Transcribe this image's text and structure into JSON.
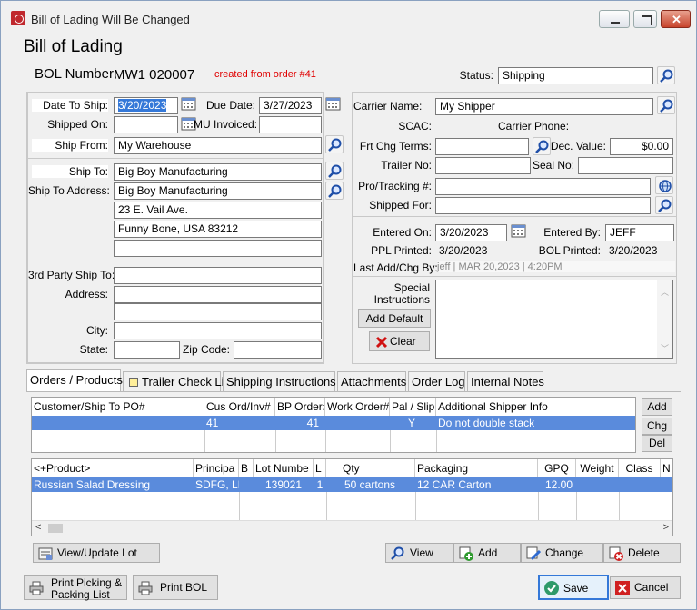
{
  "window": {
    "title": "Bill of Lading Will Be Changed"
  },
  "header": {
    "page_title": "Bill of Lading",
    "bol_label": "BOL Number:",
    "bol_number": "MW1 020007",
    "created_from": "created from order #41",
    "status_label": "Status:",
    "status_value": "Shipping"
  },
  "left": {
    "date_to_ship_label": "Date To Ship:",
    "date_to_ship": "3/20/2023",
    "due_date_label": "Due Date:",
    "due_date": "3/27/2023",
    "shipped_on_label": "Shipped On:",
    "shipped_on": "",
    "mu_invoiced_label": "MU Invoiced:",
    "mu_invoiced": "",
    "ship_from_label": "Ship From:",
    "ship_from": "My Warehouse",
    "ship_to_label": "Ship To:",
    "ship_to": "Big Boy Manufacturing",
    "ship_to_address_label": "Ship To Address:",
    "ship_to_address": [
      "Big Boy Manufacturing",
      "23 E. Vail Ave.",
      "Funny Bone, USA 83212",
      ""
    ],
    "third_party_label": "3rd Party Ship To:",
    "third_party": "",
    "address_label": "Address:",
    "address1": "",
    "address2": "",
    "city_label": "City:",
    "city": "",
    "state_label": "State:",
    "state": "",
    "zip_label": "Zip Code:",
    "zip": ""
  },
  "right": {
    "carrier_name_label": "Carrier Name:",
    "carrier_name": "My Shipper",
    "scac_label": "SCAC:",
    "carrier_phone_label": "Carrier Phone:",
    "frt_chg_terms_label": "Frt Chg Terms:",
    "frt_chg_terms": "",
    "dec_value_label": "Dec. Value:",
    "dec_value": "$0.00",
    "trailer_no_label": "Trailer No:",
    "trailer_no": "",
    "seal_no_label": "Seal No:",
    "seal_no": "",
    "pro_tracking_label": "Pro/Tracking #:",
    "pro_tracking": "",
    "shipped_for_label": "Shipped For:",
    "shipped_for": "",
    "entered_on_label": "Entered On:",
    "entered_on": "3/20/2023",
    "entered_by_label": "Entered By:",
    "entered_by": "JEFF",
    "ppl_printed_label": "PPL Printed:",
    "ppl_printed": "3/20/2023",
    "bol_printed_label": "BOL Printed:",
    "bol_printed": "3/20/2023",
    "last_add_label": "Last Add/Chg By:",
    "last_add": "jeff | MAR 20,2023 | 4:20PM",
    "special_instructions_label_1": "Special",
    "special_instructions_label_2": "Instructions",
    "add_default_label": "Add Default",
    "clear_label": "Clear"
  },
  "tabs": [
    "Orders / Products",
    "Trailer Check List",
    "Shipping Instructions",
    "Attachments",
    "Order Log",
    "Internal Notes"
  ],
  "orders_grid": {
    "headers": [
      "Customer/Ship To PO#",
      "Cus Ord/Inv#",
      "BP Order#",
      "Work Order#",
      "Pal / Slip",
      "Additional Shipper Info"
    ],
    "row": [
      "",
      "41",
      "41",
      "",
      "Y",
      "Do not double stack"
    ]
  },
  "order_buttons": {
    "add": "Add",
    "chg": "Chg",
    "del": "Del"
  },
  "products_grid": {
    "headers": [
      "<+Product>",
      "Principa",
      "B",
      "Lot Numbe",
      "L",
      "Qty",
      "Packaging",
      "GPQ",
      "Weight",
      "Class",
      "N"
    ],
    "row": [
      "Russian Salad Dressing",
      "SDFG, LI",
      "",
      "139021",
      "1",
      "50 cartons",
      "12 CAR Carton",
      "12.00",
      "",
      "",
      ""
    ]
  },
  "product_buttons": {
    "view_update_lot": "View/Update Lot",
    "view": "View",
    "add": "Add",
    "change": "Change",
    "delete": "Delete"
  },
  "footer": {
    "print_picking_1": "Print Picking &",
    "print_picking_2": "Packing List",
    "print_bol": "Print BOL",
    "save": "Save",
    "cancel": "Cancel"
  },
  "colors": {
    "selection": "#5a8bdc",
    "created_from": "#e00000",
    "accent": "#3366cc"
  }
}
